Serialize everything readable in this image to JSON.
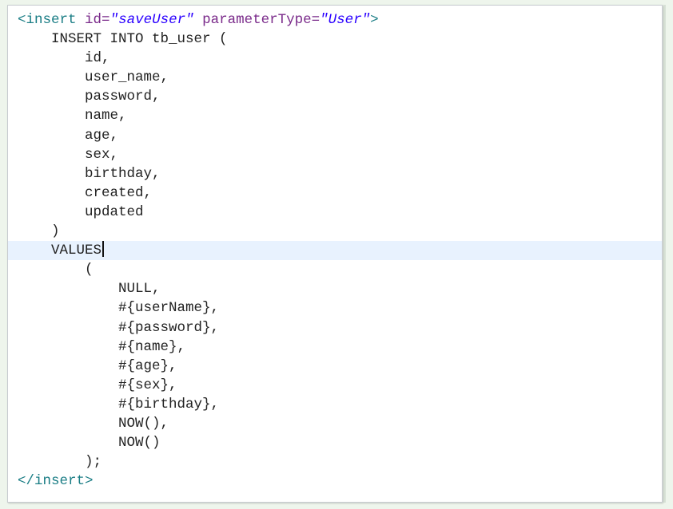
{
  "editor": {
    "lines": [
      {
        "indent": "",
        "tokens": [
          {
            "type": "tag",
            "text": "<insert"
          },
          {
            "type": "plain",
            "text": " "
          },
          {
            "type": "attr",
            "text": "id"
          },
          {
            "type": "attr",
            "text": "="
          },
          {
            "type": "str",
            "text": "\"saveUser\""
          },
          {
            "type": "plain",
            "text": " "
          },
          {
            "type": "attr",
            "text": "parameterType"
          },
          {
            "type": "attr",
            "text": "="
          },
          {
            "type": "str",
            "text": "\"User\""
          },
          {
            "type": "tag",
            "text": ">"
          }
        ]
      },
      {
        "indent": "    ",
        "tokens": [
          {
            "type": "plain",
            "text": "INSERT INTO tb_user ("
          }
        ]
      },
      {
        "indent": "        ",
        "tokens": [
          {
            "type": "plain",
            "text": "id,"
          }
        ]
      },
      {
        "indent": "        ",
        "tokens": [
          {
            "type": "plain",
            "text": "user_name,"
          }
        ]
      },
      {
        "indent": "        ",
        "tokens": [
          {
            "type": "plain",
            "text": "password,"
          }
        ]
      },
      {
        "indent": "        ",
        "tokens": [
          {
            "type": "plain",
            "text": "name,"
          }
        ]
      },
      {
        "indent": "        ",
        "tokens": [
          {
            "type": "plain",
            "text": "age,"
          }
        ]
      },
      {
        "indent": "        ",
        "tokens": [
          {
            "type": "plain",
            "text": "sex,"
          }
        ]
      },
      {
        "indent": "        ",
        "tokens": [
          {
            "type": "plain",
            "text": "birthday,"
          }
        ]
      },
      {
        "indent": "        ",
        "tokens": [
          {
            "type": "plain",
            "text": "created,"
          }
        ]
      },
      {
        "indent": "        ",
        "tokens": [
          {
            "type": "plain",
            "text": "updated"
          }
        ]
      },
      {
        "indent": "    ",
        "tokens": [
          {
            "type": "plain",
            "text": ")"
          }
        ]
      },
      {
        "indent": "    ",
        "current": true,
        "tokens": [
          {
            "type": "plain",
            "text": "VALUES"
          }
        ]
      },
      {
        "indent": "        ",
        "tokens": [
          {
            "type": "plain",
            "text": "("
          }
        ]
      },
      {
        "indent": "            ",
        "tokens": [
          {
            "type": "plain",
            "text": "NULL,"
          }
        ]
      },
      {
        "indent": "            ",
        "tokens": [
          {
            "type": "plain",
            "text": "#{userName},"
          }
        ]
      },
      {
        "indent": "            ",
        "tokens": [
          {
            "type": "plain",
            "text": "#{password},"
          }
        ]
      },
      {
        "indent": "            ",
        "tokens": [
          {
            "type": "plain",
            "text": "#{name},"
          }
        ]
      },
      {
        "indent": "            ",
        "tokens": [
          {
            "type": "plain",
            "text": "#{age},"
          }
        ]
      },
      {
        "indent": "            ",
        "tokens": [
          {
            "type": "plain",
            "text": "#{sex},"
          }
        ]
      },
      {
        "indent": "            ",
        "tokens": [
          {
            "type": "plain",
            "text": "#{birthday},"
          }
        ]
      },
      {
        "indent": "            ",
        "tokens": [
          {
            "type": "plain",
            "text": "NOW(),"
          }
        ]
      },
      {
        "indent": "            ",
        "tokens": [
          {
            "type": "plain",
            "text": "NOW()"
          }
        ]
      },
      {
        "indent": "        ",
        "tokens": [
          {
            "type": "plain",
            "text": ");"
          }
        ]
      },
      {
        "indent": "",
        "tokens": [
          {
            "type": "tag",
            "text": "</insert>"
          }
        ]
      }
    ],
    "colors": {
      "tag": "#1a7d85",
      "attribute": "#7a2a8a",
      "string": "#2a00ff",
      "text": "#222222",
      "current_line": "#e8f2fe",
      "background": "#ffffff"
    }
  }
}
